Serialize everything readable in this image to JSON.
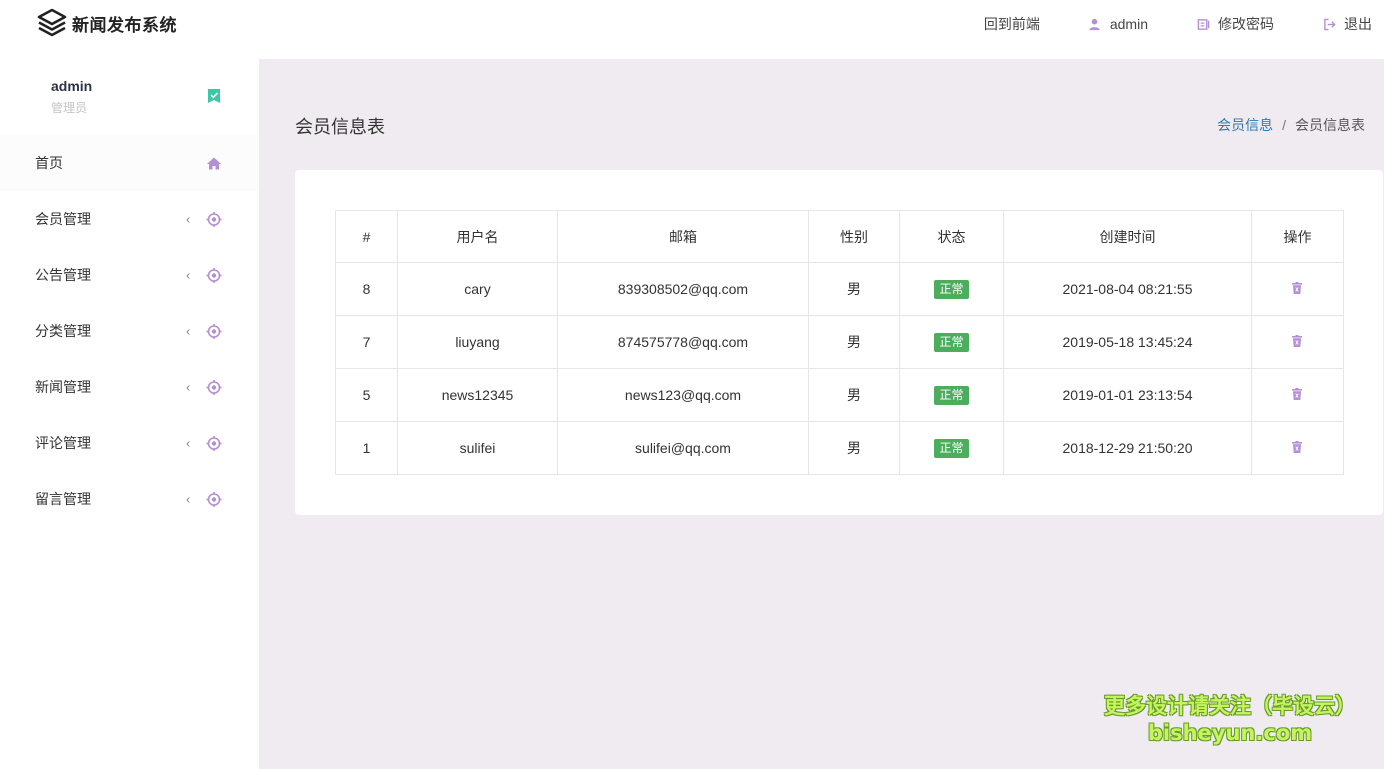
{
  "app": {
    "brand": "新闻发布系统"
  },
  "topnav": {
    "frontend_label": "回到前端",
    "user_label": "admin",
    "password_label": "修改密码",
    "logout_label": "退出"
  },
  "profile": {
    "name": "admin",
    "role": "管理员"
  },
  "sidebar": {
    "items": [
      {
        "label": "首页"
      },
      {
        "label": "会员管理"
      },
      {
        "label": "公告管理"
      },
      {
        "label": "分类管理"
      },
      {
        "label": "新闻管理"
      },
      {
        "label": "评论管理"
      },
      {
        "label": "留言管理"
      }
    ],
    "chevron": "‹"
  },
  "page": {
    "title": "会员信息表"
  },
  "breadcrumb": {
    "parent": "会员信息",
    "separator": "/",
    "current": "会员信息表"
  },
  "table": {
    "headers": [
      "#",
      "用户名",
      "邮箱",
      "性别",
      "状态",
      "创建时间",
      "操作"
    ],
    "rows": [
      {
        "id": "8",
        "username": "cary",
        "email": "839308502@qq.com",
        "gender": "男",
        "status": "正常",
        "created": "2021-08-04 08:21:55"
      },
      {
        "id": "7",
        "username": "liuyang",
        "email": "874575778@qq.com",
        "gender": "男",
        "status": "正常",
        "created": "2019-05-18 13:45:24"
      },
      {
        "id": "5",
        "username": "news12345",
        "email": "news123@qq.com",
        "gender": "男",
        "status": "正常",
        "created": "2019-01-01 23:13:54"
      },
      {
        "id": "1",
        "username": "sulifei",
        "email": "sulifei@qq.com",
        "gender": "男",
        "status": "正常",
        "created": "2018-12-29 21:50:20"
      }
    ]
  },
  "watermark": {
    "line1": "更多设计请关注（毕设云）",
    "line2": "bisheyun.com"
  },
  "colors": {
    "accent_purple": "#b58fd6",
    "status_green": "#4cae5d",
    "link_blue": "#2a7ab8",
    "badge_teal": "#3cc7a6"
  }
}
